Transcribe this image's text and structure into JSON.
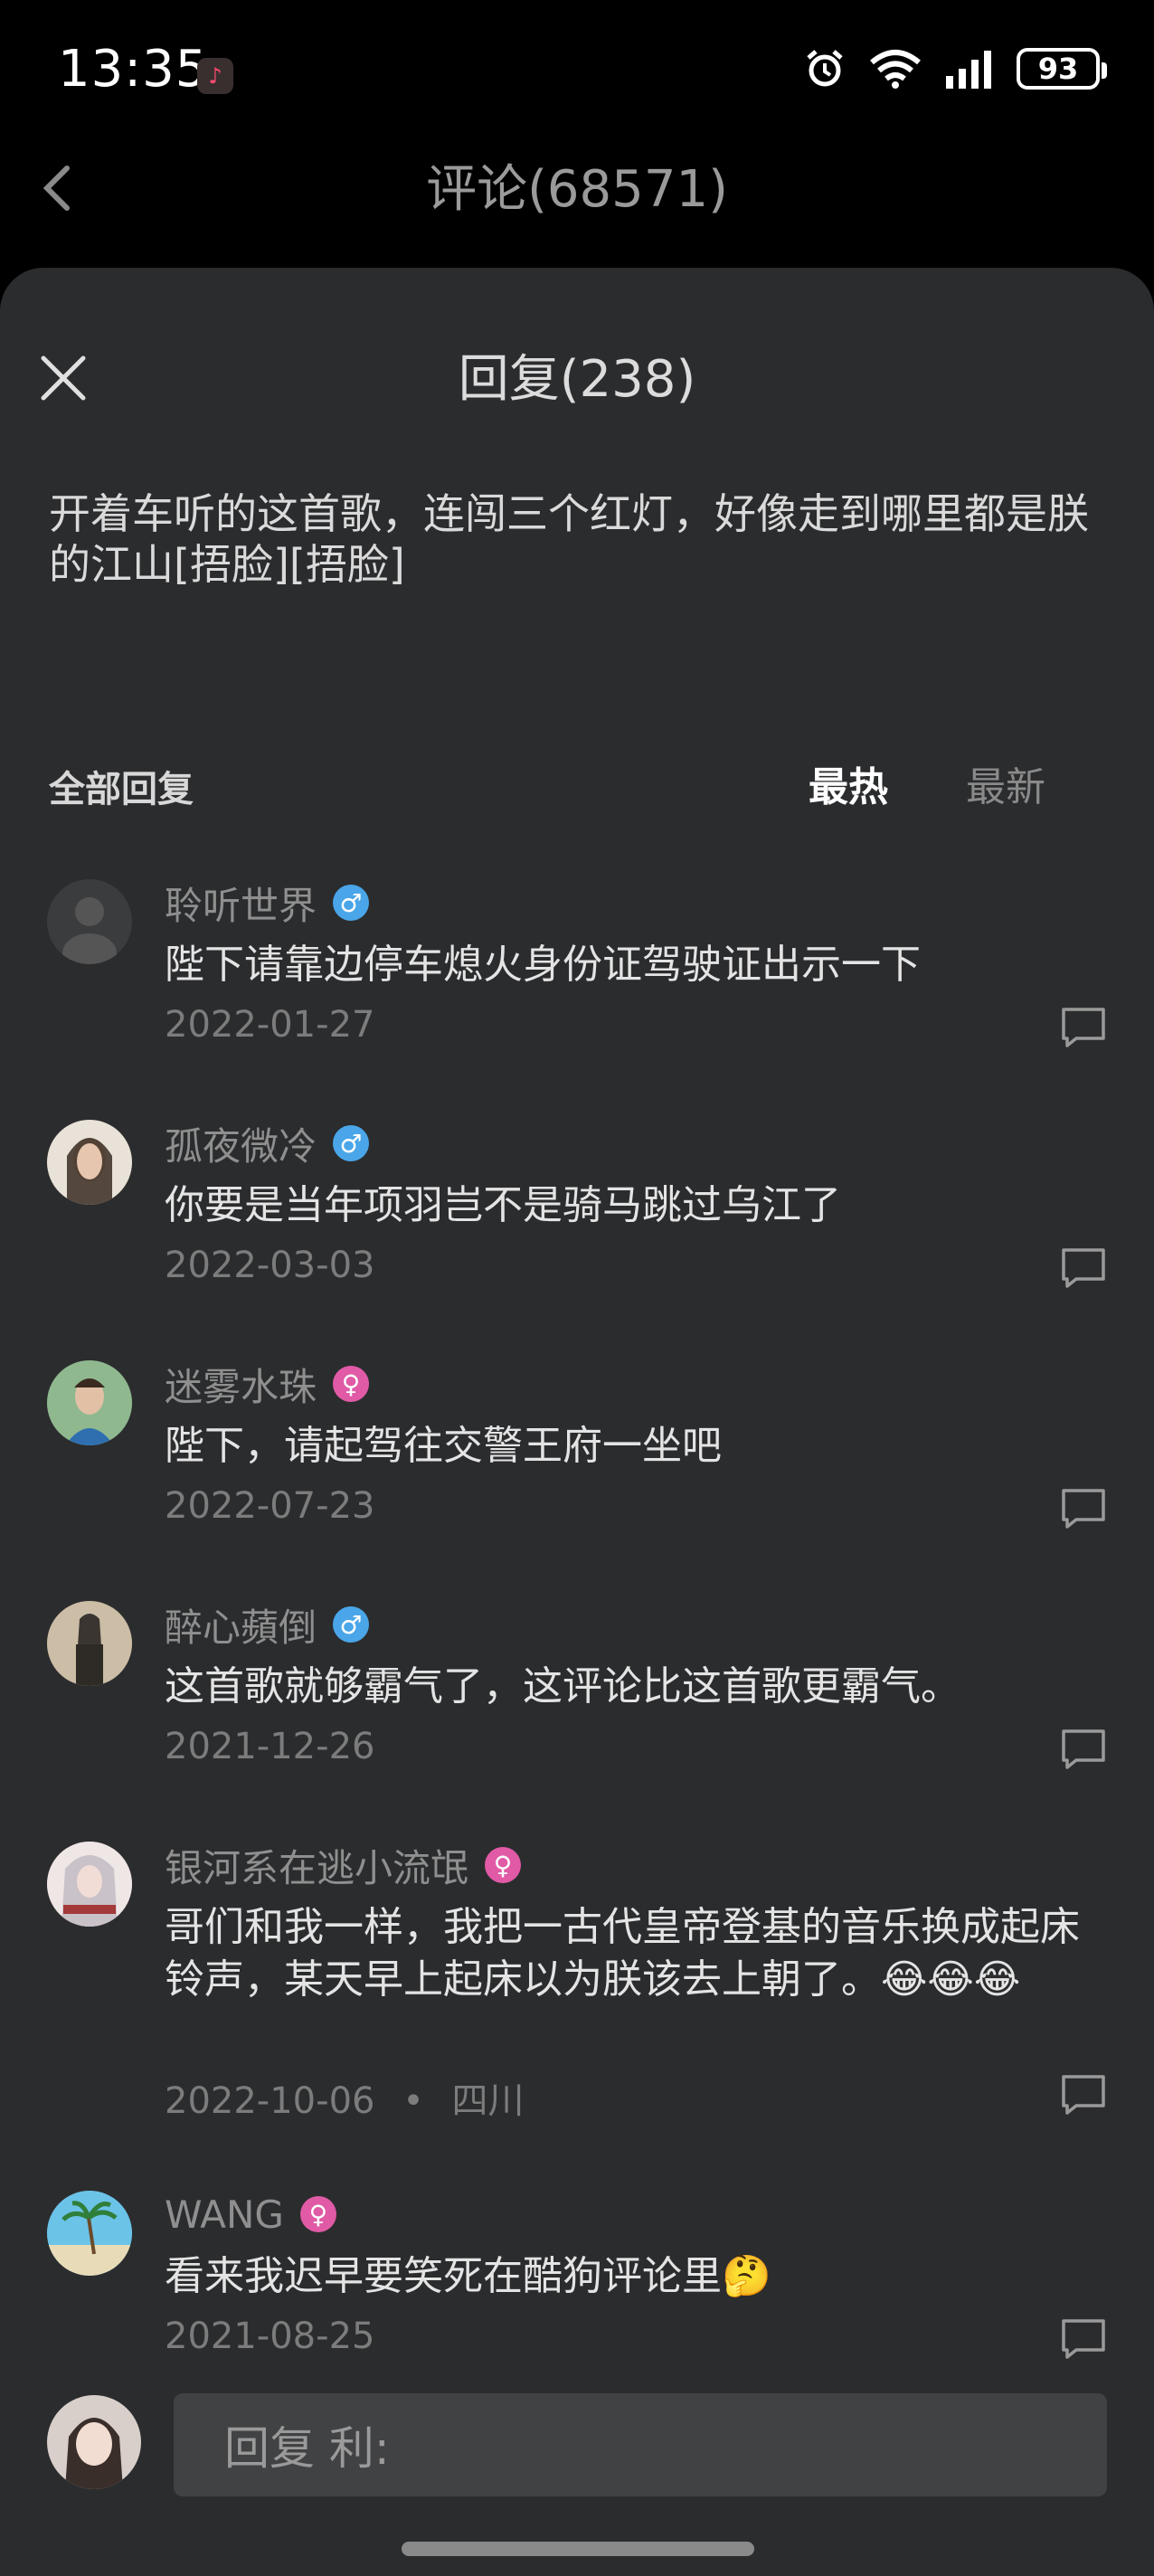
{
  "status": {
    "time": "13:35",
    "battery": "93"
  },
  "header": {
    "title": "评论(68571)"
  },
  "sheet": {
    "title": "回复(238)",
    "original_comment": "开着车听的这首歌，连闯三个红灯，好像走到哪里都是朕的江山[捂脸][捂脸]",
    "section_title": "全部回复",
    "sort_hot": "最热",
    "sort_new": "最新"
  },
  "replies": [
    {
      "name": "聆听世界",
      "gender": "male",
      "text": "陛下请靠边停车熄火身份证驾驶证出示一下",
      "date": "2022-01-27",
      "avatar_color": "#3b3c3e"
    },
    {
      "name": "孤夜微冷",
      "gender": "male",
      "text": "你要是当年项羽岂不是骑马跳过乌江了",
      "date": "2022-03-03",
      "avatar_color": "#6b5a4a"
    },
    {
      "name": "迷雾水珠",
      "gender": "female",
      "text": "陛下，请起驾往交警王府一坐吧",
      "date": "2022-07-23",
      "avatar_color": "#4d7a5a"
    },
    {
      "name": "醉心蘋倒",
      "gender": "male",
      "text": "这首歌就够霸气了，这评论比这首歌更霸气。",
      "date": "2021-12-26",
      "avatar_color": "#7a6a55"
    },
    {
      "name": "银河系在逃小流氓",
      "gender": "female",
      "text": "哥们和我一样，我把一古代皇帝登基的音乐换成起床铃声，某天早上起床以为朕该去上朝了。😂😂😂",
      "date": "2022-10-06",
      "location": "四川",
      "avatar_color": "#b48a8a"
    },
    {
      "name": "WANG",
      "gender": "female",
      "text": "看来我迟早要笑死在酷狗评论里🤔",
      "date": "2021-08-25",
      "avatar_color": "#3f8fb0"
    }
  ],
  "input": {
    "placeholder": "回复 利:"
  },
  "colors": {
    "sheet_bg": "#2b2c2e",
    "male": "#4aa6e8",
    "female": "#e05aa6"
  }
}
